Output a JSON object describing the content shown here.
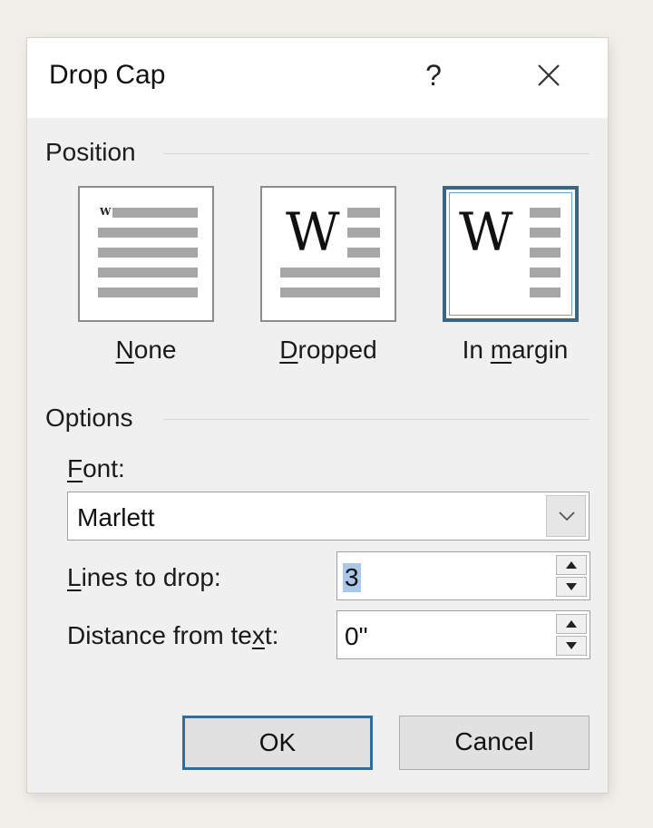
{
  "dialog": {
    "title": "Drop Cap",
    "help": "?",
    "position_label": "Position",
    "positions": [
      {
        "id": "none",
        "label": "None",
        "selected": false
      },
      {
        "id": "dropped",
        "label": "Dropped",
        "selected": false
      },
      {
        "id": "in_margin",
        "label": "In margin",
        "selected": true
      }
    ],
    "preview_letter": "W",
    "options_label": "Options",
    "font_label": "Font:",
    "font_value": "Marlett",
    "lines_label": "Lines to drop:",
    "lines_value": "3",
    "distance_label": "Distance from text:",
    "distance_value": "0\"",
    "ok_label": "OK",
    "cancel_label": "Cancel"
  },
  "icons": {
    "close": "close-icon",
    "combo_arrow": "chevron-down-icon",
    "spin_up": "triangle-up-icon",
    "spin_down": "triangle-down-icon"
  },
  "colors": {
    "selection_border": "#3c6680",
    "default_button_border": "#2a6ea8",
    "text_selection": "#a9c8e8"
  }
}
